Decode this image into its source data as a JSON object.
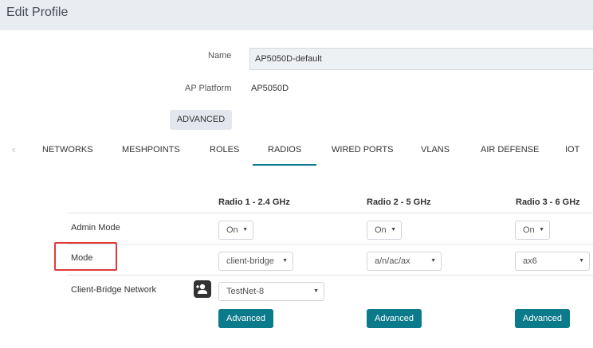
{
  "header": {
    "title": "Edit Profile"
  },
  "profile": {
    "name_label": "Name",
    "name_value": "AP5050D-default",
    "platform_label": "AP Platform",
    "platform_value": "AP5050D",
    "advanced_label": "ADVANCED"
  },
  "tabs": {
    "items": [
      "NETWORKS",
      "MESHPOINTS",
      "ROLES",
      "RADIOS",
      "WIRED PORTS",
      "VLANS",
      "AIR DEFENSE",
      "IOT"
    ],
    "active": "RADIOS"
  },
  "radios": {
    "columns": [
      "Radio 1 - 2.4 GHz",
      "Radio 2 - 5 GHz",
      "Radio 3 - 6 GHz"
    ],
    "rows": {
      "admin_mode": {
        "label": "Admin Mode",
        "values": [
          "On",
          "On",
          "On"
        ]
      },
      "mode": {
        "label": "Mode",
        "values": [
          "client-bridge",
          "a/n/ac/ax",
          "ax6"
        ]
      },
      "client_bridge_network": {
        "label": "Client-Bridge Network",
        "value": "TestNet-8"
      }
    },
    "advanced_button": "Advanced"
  },
  "icons": {
    "tab_prev": "chevron-left-icon",
    "user_add": "user-add-icon",
    "caret": "caret-down-icon"
  },
  "colors": {
    "accent": "#0b7a8a",
    "highlight": "#e03a3a",
    "header_bg": "#e9ecf1"
  }
}
